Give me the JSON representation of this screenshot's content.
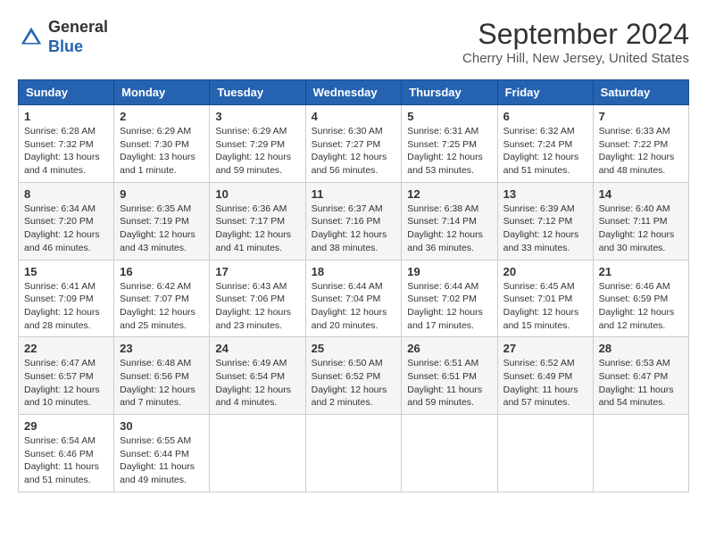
{
  "header": {
    "logo_general": "General",
    "logo_blue": "Blue",
    "month_title": "September 2024",
    "location": "Cherry Hill, New Jersey, United States"
  },
  "weekdays": [
    "Sunday",
    "Monday",
    "Tuesday",
    "Wednesday",
    "Thursday",
    "Friday",
    "Saturday"
  ],
  "weeks": [
    [
      {
        "day": "1",
        "sunrise": "Sunrise: 6:28 AM",
        "sunset": "Sunset: 7:32 PM",
        "daylight": "Daylight: 13 hours and 4 minutes."
      },
      {
        "day": "2",
        "sunrise": "Sunrise: 6:29 AM",
        "sunset": "Sunset: 7:30 PM",
        "daylight": "Daylight: 13 hours and 1 minute."
      },
      {
        "day": "3",
        "sunrise": "Sunrise: 6:29 AM",
        "sunset": "Sunset: 7:29 PM",
        "daylight": "Daylight: 12 hours and 59 minutes."
      },
      {
        "day": "4",
        "sunrise": "Sunrise: 6:30 AM",
        "sunset": "Sunset: 7:27 PM",
        "daylight": "Daylight: 12 hours and 56 minutes."
      },
      {
        "day": "5",
        "sunrise": "Sunrise: 6:31 AM",
        "sunset": "Sunset: 7:25 PM",
        "daylight": "Daylight: 12 hours and 53 minutes."
      },
      {
        "day": "6",
        "sunrise": "Sunrise: 6:32 AM",
        "sunset": "Sunset: 7:24 PM",
        "daylight": "Daylight: 12 hours and 51 minutes."
      },
      {
        "day": "7",
        "sunrise": "Sunrise: 6:33 AM",
        "sunset": "Sunset: 7:22 PM",
        "daylight": "Daylight: 12 hours and 48 minutes."
      }
    ],
    [
      {
        "day": "8",
        "sunrise": "Sunrise: 6:34 AM",
        "sunset": "Sunset: 7:20 PM",
        "daylight": "Daylight: 12 hours and 46 minutes."
      },
      {
        "day": "9",
        "sunrise": "Sunrise: 6:35 AM",
        "sunset": "Sunset: 7:19 PM",
        "daylight": "Daylight: 12 hours and 43 minutes."
      },
      {
        "day": "10",
        "sunrise": "Sunrise: 6:36 AM",
        "sunset": "Sunset: 7:17 PM",
        "daylight": "Daylight: 12 hours and 41 minutes."
      },
      {
        "day": "11",
        "sunrise": "Sunrise: 6:37 AM",
        "sunset": "Sunset: 7:16 PM",
        "daylight": "Daylight: 12 hours and 38 minutes."
      },
      {
        "day": "12",
        "sunrise": "Sunrise: 6:38 AM",
        "sunset": "Sunset: 7:14 PM",
        "daylight": "Daylight: 12 hours and 36 minutes."
      },
      {
        "day": "13",
        "sunrise": "Sunrise: 6:39 AM",
        "sunset": "Sunset: 7:12 PM",
        "daylight": "Daylight: 12 hours and 33 minutes."
      },
      {
        "day": "14",
        "sunrise": "Sunrise: 6:40 AM",
        "sunset": "Sunset: 7:11 PM",
        "daylight": "Daylight: 12 hours and 30 minutes."
      }
    ],
    [
      {
        "day": "15",
        "sunrise": "Sunrise: 6:41 AM",
        "sunset": "Sunset: 7:09 PM",
        "daylight": "Daylight: 12 hours and 28 minutes."
      },
      {
        "day": "16",
        "sunrise": "Sunrise: 6:42 AM",
        "sunset": "Sunset: 7:07 PM",
        "daylight": "Daylight: 12 hours and 25 minutes."
      },
      {
        "day": "17",
        "sunrise": "Sunrise: 6:43 AM",
        "sunset": "Sunset: 7:06 PM",
        "daylight": "Daylight: 12 hours and 23 minutes."
      },
      {
        "day": "18",
        "sunrise": "Sunrise: 6:44 AM",
        "sunset": "Sunset: 7:04 PM",
        "daylight": "Daylight: 12 hours and 20 minutes."
      },
      {
        "day": "19",
        "sunrise": "Sunrise: 6:44 AM",
        "sunset": "Sunset: 7:02 PM",
        "daylight": "Daylight: 12 hours and 17 minutes."
      },
      {
        "day": "20",
        "sunrise": "Sunrise: 6:45 AM",
        "sunset": "Sunset: 7:01 PM",
        "daylight": "Daylight: 12 hours and 15 minutes."
      },
      {
        "day": "21",
        "sunrise": "Sunrise: 6:46 AM",
        "sunset": "Sunset: 6:59 PM",
        "daylight": "Daylight: 12 hours and 12 minutes."
      }
    ],
    [
      {
        "day": "22",
        "sunrise": "Sunrise: 6:47 AM",
        "sunset": "Sunset: 6:57 PM",
        "daylight": "Daylight: 12 hours and 10 minutes."
      },
      {
        "day": "23",
        "sunrise": "Sunrise: 6:48 AM",
        "sunset": "Sunset: 6:56 PM",
        "daylight": "Daylight: 12 hours and 7 minutes."
      },
      {
        "day": "24",
        "sunrise": "Sunrise: 6:49 AM",
        "sunset": "Sunset: 6:54 PM",
        "daylight": "Daylight: 12 hours and 4 minutes."
      },
      {
        "day": "25",
        "sunrise": "Sunrise: 6:50 AM",
        "sunset": "Sunset: 6:52 PM",
        "daylight": "Daylight: 12 hours and 2 minutes."
      },
      {
        "day": "26",
        "sunrise": "Sunrise: 6:51 AM",
        "sunset": "Sunset: 6:51 PM",
        "daylight": "Daylight: 11 hours and 59 minutes."
      },
      {
        "day": "27",
        "sunrise": "Sunrise: 6:52 AM",
        "sunset": "Sunset: 6:49 PM",
        "daylight": "Daylight: 11 hours and 57 minutes."
      },
      {
        "day": "28",
        "sunrise": "Sunrise: 6:53 AM",
        "sunset": "Sunset: 6:47 PM",
        "daylight": "Daylight: 11 hours and 54 minutes."
      }
    ],
    [
      {
        "day": "29",
        "sunrise": "Sunrise: 6:54 AM",
        "sunset": "Sunset: 6:46 PM",
        "daylight": "Daylight: 11 hours and 51 minutes."
      },
      {
        "day": "30",
        "sunrise": "Sunrise: 6:55 AM",
        "sunset": "Sunset: 6:44 PM",
        "daylight": "Daylight: 11 hours and 49 minutes."
      },
      null,
      null,
      null,
      null,
      null
    ]
  ]
}
